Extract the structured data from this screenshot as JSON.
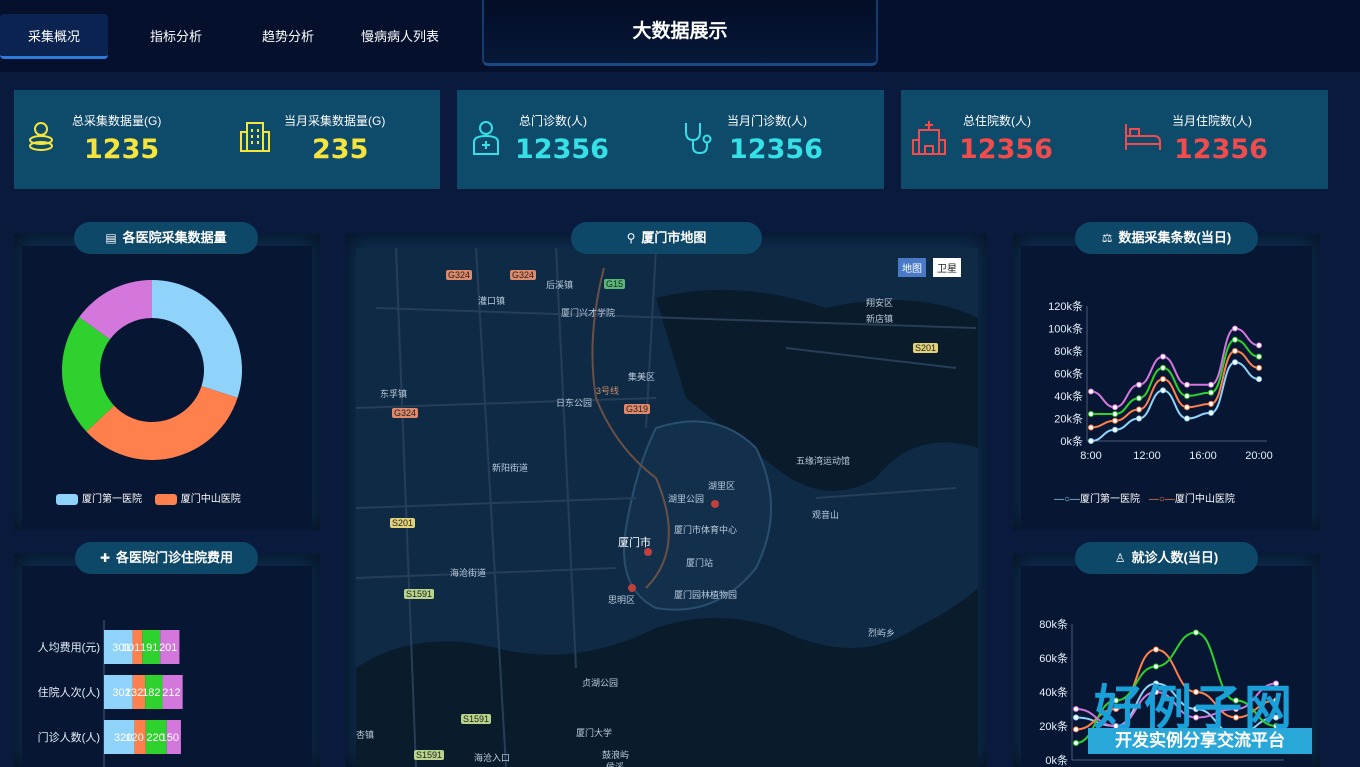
{
  "nav": {
    "tabs": [
      "采集概况",
      "指标分析",
      "趋势分析",
      "慢病病人列表"
    ],
    "title": "大数据展示"
  },
  "stats": [
    {
      "label": "总采集数据量(G)",
      "value": "1235",
      "color": "#f5e43c",
      "icon": "coins-icon"
    },
    {
      "label": "当月采集数据量(G)",
      "value": "235",
      "color": "#f5e43c",
      "icon": "building-icon"
    },
    {
      "label": "总门诊数(人)",
      "value": "12356",
      "color": "#35e0e6",
      "icon": "doctor-icon"
    },
    {
      "label": "当月门诊数(人)",
      "value": "12356",
      "color": "#35e0e6",
      "icon": "stethoscope-icon"
    },
    {
      "label": "总住院数(人)",
      "value": "12356",
      "color": "#f24b4b",
      "icon": "hospital-icon"
    },
    {
      "label": "当月住院数(人)",
      "value": "12356",
      "color": "#f24b4b",
      "icon": "bed-icon"
    }
  ],
  "panels": {
    "hospital_data": "各医院采集数据量",
    "fees": "各医院门诊住院费用",
    "map": "厦门市地图",
    "collect": "数据采集条数(当日)",
    "visits": "就诊人数(当日)"
  },
  "map": {
    "toggle": [
      "地图",
      "卫星"
    ],
    "places": [
      "后溪镇",
      "灌口镇",
      "厦门兴才学院",
      "东孚镇",
      "集美区",
      "日东公园",
      "新阳街道",
      "湖里区",
      "五缘湾运动馆",
      "翔安区",
      "新店镇",
      "湖里公园",
      "厦门市体育中心",
      "观音山",
      "厦门市",
      "厦门站",
      "思明区",
      "厦门园林植物园",
      "海沧街道",
      "鼓浪屿",
      "厦门大学",
      "烈屿乡",
      "海沧入口",
      "杏镇",
      "贞湖公园",
      "侯溪"
    ],
    "roads": [
      "G324",
      "G324",
      "G15",
      "G324",
      "G319",
      "S201",
      "S201",
      "S1591",
      "S1591",
      "S1591",
      "3号线"
    ]
  },
  "colors": {
    "blue": "#8fd3fb",
    "orange": "#ff7f4d",
    "green": "#2ed12e",
    "purple": "#d477dc"
  },
  "chart_data": [
    {
      "type": "pie",
      "title": "各医院采集数据量",
      "categories": [
        "厦门第一医院",
        "厦门中山医院",
        "",
        ""
      ],
      "values": [
        30,
        33,
        22,
        15
      ]
    },
    {
      "type": "bar",
      "title": "各医院门诊住院费用",
      "categories": [
        "人均费用(元)",
        "住院人次(人)",
        "门诊人数(人)"
      ],
      "series": [
        {
          "name": "",
          "values": [
            301,
            302,
            320
          ]
        },
        {
          "name": "",
          "values": [
            101,
            132,
            120
          ]
        },
        {
          "name": "",
          "values": [
            191,
            182,
            220
          ]
        },
        {
          "name": "",
          "values": [
            201,
            212,
            150
          ]
        }
      ]
    },
    {
      "type": "line",
      "title": "数据采集条数(当日)",
      "x": [
        8,
        10,
        12,
        14,
        16,
        18,
        20,
        22
      ],
      "xticks": [
        "8:00",
        "12:00",
        "16:00",
        "20:00"
      ],
      "yticks": [
        "0k条",
        "20k条",
        "40k条",
        "60k条",
        "80k条",
        "100k条",
        "120k条"
      ],
      "ylim": [
        0,
        120000
      ],
      "series": [
        {
          "name": "厦门第一医院",
          "values": [
            0,
            10000,
            20000,
            45000,
            20000,
            25000,
            70000,
            55000
          ]
        },
        {
          "name": "厦门中山医院",
          "values": [
            12000,
            18000,
            28000,
            55000,
            30000,
            33000,
            80000,
            65000
          ]
        },
        {
          "name": "",
          "values": [
            24000,
            24000,
            38000,
            65000,
            40000,
            43000,
            90000,
            75000
          ]
        },
        {
          "name": "",
          "values": [
            44000,
            30000,
            50000,
            75000,
            50000,
            50000,
            100000,
            85000
          ]
        }
      ]
    },
    {
      "type": "line",
      "title": "就诊人数(当日)",
      "yticks": [
        "0k条",
        "20k条",
        "40k条",
        "60k条",
        "80k条"
      ],
      "ylim": [
        0,
        80000
      ],
      "series": [
        {
          "name": "",
          "values": [
            25000,
            20000,
            45000,
            30000,
            15000,
            25000
          ]
        },
        {
          "name": "",
          "values": [
            18000,
            30000,
            65000,
            40000,
            25000,
            35000
          ]
        },
        {
          "name": "",
          "values": [
            10000,
            35000,
            55000,
            75000,
            35000,
            20000
          ]
        },
        {
          "name": "",
          "values": [
            30000,
            20000,
            40000,
            25000,
            30000,
            45000
          ]
        }
      ]
    }
  ]
}
